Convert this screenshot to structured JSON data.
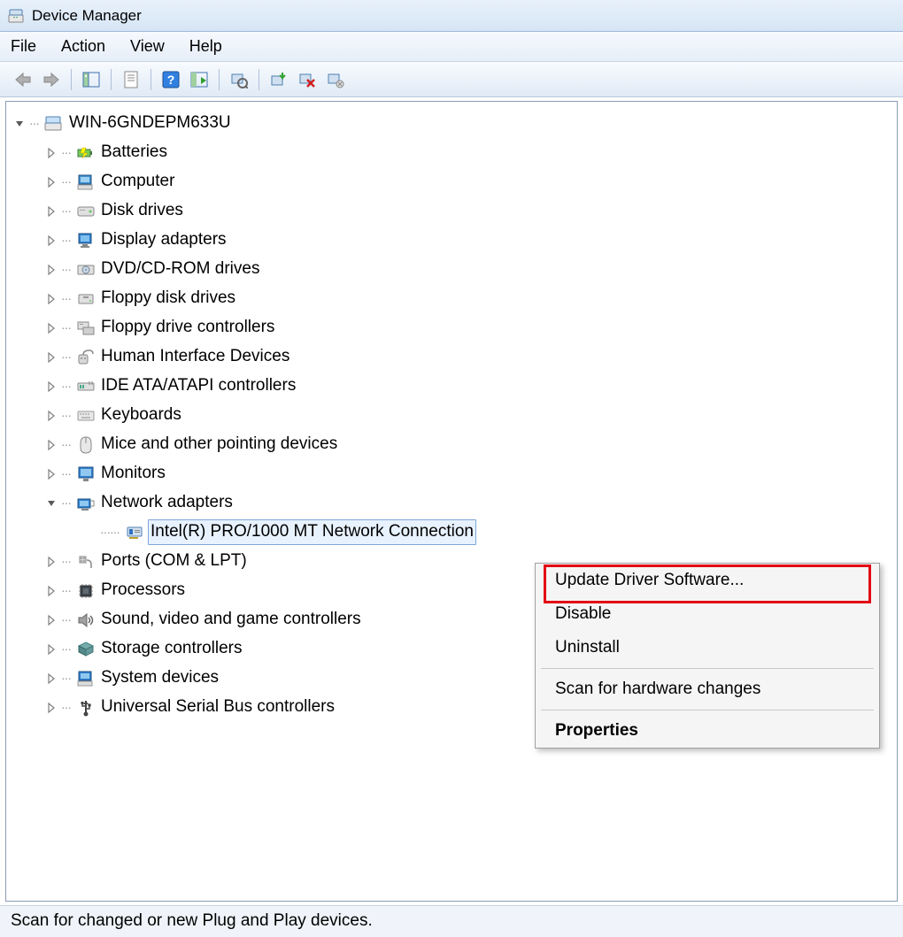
{
  "window": {
    "title": "Device Manager"
  },
  "menu": {
    "file": "File",
    "action": "Action",
    "view": "View",
    "help": "Help"
  },
  "toolbar_icons": {
    "back": "back-arrow-icon",
    "forward": "forward-arrow-icon",
    "show_hide": "show-hide-console-icon",
    "properties": "properties-icon",
    "help": "help-icon",
    "scan": "scan-hardware-icon",
    "remote": "remote-computer-icon",
    "update": "update-driver-icon",
    "disable": "disable-device-icon",
    "uninstall": "uninstall-device-icon"
  },
  "tree": {
    "root": "WIN-6GNDEPM633U",
    "items": [
      {
        "label": "Batteries",
        "icon": "battery-icon"
      },
      {
        "label": "Computer",
        "icon": "computer-icon"
      },
      {
        "label": "Disk drives",
        "icon": "disk-drive-icon"
      },
      {
        "label": "Display adapters",
        "icon": "display-adapter-icon"
      },
      {
        "label": "DVD/CD-ROM drives",
        "icon": "optical-drive-icon"
      },
      {
        "label": "Floppy disk drives",
        "icon": "floppy-disk-icon"
      },
      {
        "label": "Floppy drive controllers",
        "icon": "floppy-controller-icon"
      },
      {
        "label": "Human Interface Devices",
        "icon": "hid-icon"
      },
      {
        "label": "IDE ATA/ATAPI controllers",
        "icon": "ide-controller-icon"
      },
      {
        "label": "Keyboards",
        "icon": "keyboard-icon"
      },
      {
        "label": "Mice and other pointing devices",
        "icon": "mouse-icon"
      },
      {
        "label": "Monitors",
        "icon": "monitor-icon"
      },
      {
        "label": "Network adapters",
        "icon": "network-adapter-icon",
        "expanded": true,
        "children": [
          {
            "label": "Intel(R) PRO/1000 MT Network Connection",
            "icon": "network-card-icon",
            "selected": true
          }
        ]
      },
      {
        "label": "Ports (COM & LPT)",
        "icon": "ports-icon"
      },
      {
        "label": "Processors",
        "icon": "processor-icon"
      },
      {
        "label": "Sound, video and game controllers",
        "icon": "sound-icon"
      },
      {
        "label": "Storage controllers",
        "icon": "storage-controller-icon"
      },
      {
        "label": "System devices",
        "icon": "system-device-icon"
      },
      {
        "label": "Universal Serial Bus controllers",
        "icon": "usb-icon"
      }
    ]
  },
  "context_menu": {
    "update": "Update Driver Software...",
    "disable": "Disable",
    "uninstall": "Uninstall",
    "scan": "Scan for hardware changes",
    "properties": "Properties"
  },
  "status": "Scan for changed or new Plug and Play devices."
}
